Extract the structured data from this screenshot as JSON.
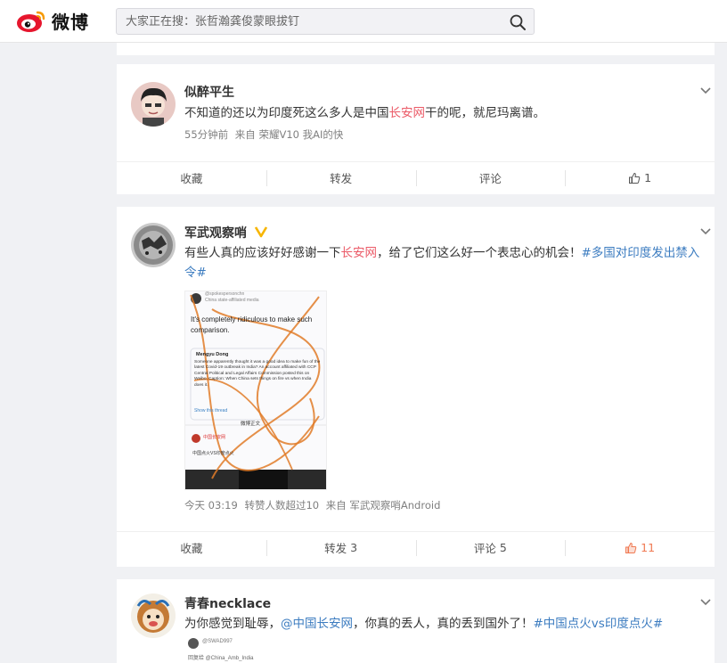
{
  "nav": {
    "logo_text": "微博",
    "search_placeholder": "大家正在搜：张哲瀚龚俊蒙眼拔钉"
  },
  "posts": [
    {
      "user": "似醉平生",
      "text_a": "不知道的还以为印度死这么多人是中国",
      "text_hl": "长安网",
      "text_b": "干的呢，就尼玛离谱。",
      "time": "55分钟前",
      "source": "来自 荣耀V10 我AI的快",
      "actions": {
        "fav": "收藏",
        "repost": "转发",
        "comment": "评论",
        "like_count": "1"
      }
    },
    {
      "user": "军武观察哨",
      "text_a": "有些人真的应该好好感谢一下",
      "text_hl": "长安网",
      "text_b": "，给了它们这么好一个表忠心的机会！",
      "topic": "#多国对印度发出禁入令#",
      "time": "今天 03:19",
      "extra": "转赞人数超过10",
      "source": "来自 军武观察哨Android",
      "media": {
        "handle": "@spokespersonchn",
        "affiliation": "China state-affiliated media",
        "quote": "It's completely ridiculous to make such comparison.",
        "inner_user": "Mengyu Dong",
        "inner_text": "Someone apparently thought it was a good idea to make fun of the latest Covid-19 outbreak in India? An account affiliated with CCP Central Political and Legal Affairs Commission posted this on Weibo. Caption: When China sets things on fire vs when India does it.",
        "show_thread": "Show this thread",
        "weibo_label": "微博正文",
        "weibo_user": "中国长安网",
        "weibo_text": "中国点火VS印度点火"
      },
      "actions": {
        "fav": "收藏",
        "repost": "转发",
        "repost_count": "3",
        "comment": "评论",
        "comment_count": "5",
        "like_count": "11"
      }
    },
    {
      "user": "青春necklace",
      "text_a": "为你感觉到耻辱，",
      "mention": "@中国长安网",
      "text_b": "，你真的丢人，真的丢到国外了！",
      "topic": "#中国点火vs印度点火#",
      "sub_user": "@SWAD997",
      "sub_text": "回复给 @China_Amb_India"
    }
  ],
  "colors": {
    "accent_red": "#eb5b68",
    "topic_blue": "#3c7cc0",
    "like_orange": "#f07a53"
  }
}
